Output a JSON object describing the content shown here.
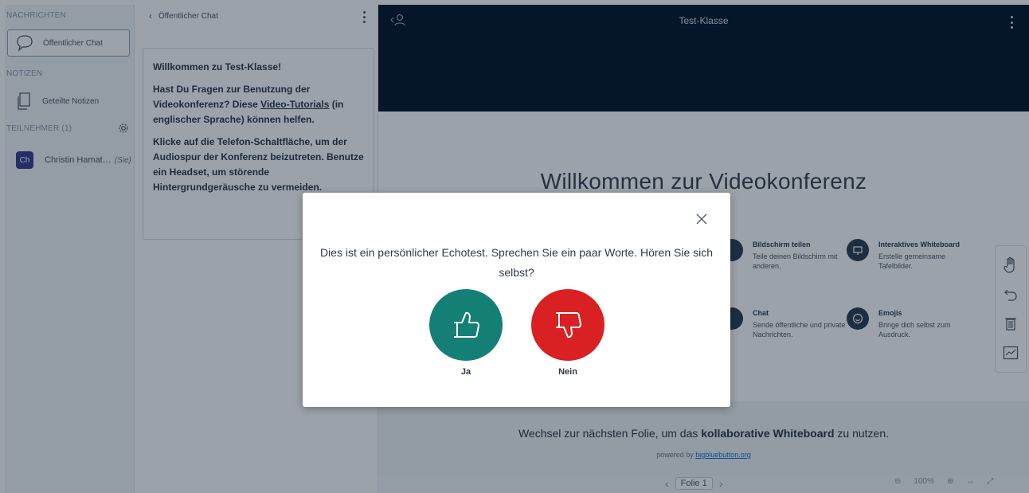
{
  "sidebar": {
    "messages_title": "NACHRICHTEN",
    "public_chat_label": "Öffentlicher Chat",
    "notes_title": "NOTIZEN",
    "shared_notes_label": "Geteilte Notizen",
    "participants_title": "TEILNEHMER (1)",
    "user": {
      "initials": "Ch",
      "name": "Christin Hamat…",
      "you_label": "(Sie)"
    }
  },
  "chat": {
    "header_title": "Öffentlicher Chat",
    "welcome_line1_pre": "Willkommen zu ",
    "welcome_line1_bold": "Test-Klasse",
    "welcome_line1_post": "!",
    "welcome_p2_pre": "Hast Du Fragen zur Benutzung der Videokonferenz? Diese ",
    "welcome_p2_link": "Video-Tutorials",
    "welcome_p2_post": " (in englischer Sprache) können helfen.",
    "welcome_p3": "Klicke auf die Telefon-Schaltfläche, um der Audiospur der Konferenz beizutreten. Benutze ein Headset, um störende Hintergrundgeräusche zu vermeiden."
  },
  "presentation": {
    "title": "Test-Klasse",
    "minimize_label": "–",
    "slide": {
      "title": "Willkommen zur Videokonferenz",
      "features": [
        {
          "title": "Bildschirm teilen",
          "desc": "Teile deinen Bildschirm mit anderen.",
          "icon": "screen-share-icon"
        },
        {
          "title": "Interaktives Whiteboard",
          "desc": "Erstelle gemeinsame Tafelbilder.",
          "icon": "whiteboard-icon"
        },
        {
          "title": "Chat",
          "desc": "Sende öffentliche und private Nachrichten.",
          "icon": "chat-icon"
        },
        {
          "title": "Emojis",
          "desc": "Bringe dich selbst zum Ausdruck.",
          "icon": "emoji-icon"
        }
      ],
      "footer_pre": "Wechsel zur nächsten Folie, um das ",
      "footer_bold": "kollaborative Whiteboard",
      "footer_post": " zu nutzen.",
      "powered_pre": "powered by ",
      "powered_link": "bigbluebutton.org"
    },
    "bottombar": {
      "slide_select": "Folie 1",
      "zoom": "100%"
    }
  },
  "modal": {
    "text": "Dies ist ein persönlicher Echotest. Sprechen Sie ein paar Worte. Hören Sie sich selbst?",
    "yes_label": "Ja",
    "no_label": "Nein",
    "colors": {
      "yes": "#148075",
      "no": "#d92123"
    }
  }
}
